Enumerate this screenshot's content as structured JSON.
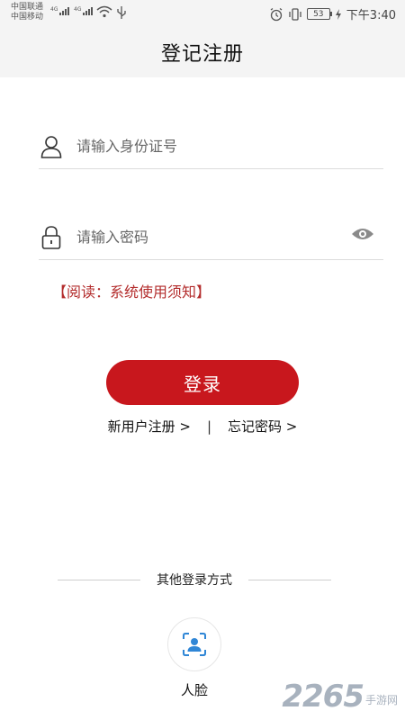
{
  "status_bar": {
    "carrier_1": "中国联通",
    "carrier_2": "中国移动",
    "network_1": "4G",
    "network_2": "4G",
    "battery_level": "53",
    "time": "下午3:40"
  },
  "header": {
    "title": "登记注册"
  },
  "form": {
    "id_field": {
      "placeholder": "请输入身份证号",
      "value": ""
    },
    "password_field": {
      "placeholder": "请输入密码",
      "value": ""
    },
    "notice": "【阅读：系统使用须知】",
    "login_label": "登录"
  },
  "links": {
    "register": "新用户注册 >",
    "separator": "|",
    "forgot": "忘记密码 >"
  },
  "other_login": {
    "title": "其他登录方式",
    "face_label": "人脸"
  },
  "watermark": {
    "number": "2265",
    "site": "手游网"
  },
  "colors": {
    "accent": "#c8171d",
    "notice": "#b32c2c",
    "face_icon": "#2f86d6"
  }
}
